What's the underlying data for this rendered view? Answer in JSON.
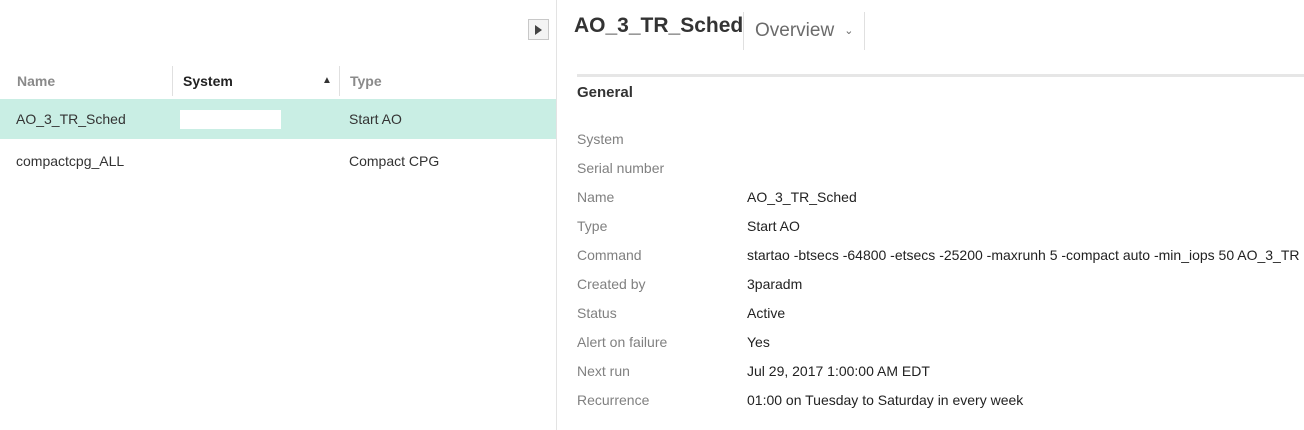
{
  "list": {
    "columns": [
      {
        "label": "Name"
      },
      {
        "label": "System",
        "sort": "ascending"
      },
      {
        "label": "Type"
      }
    ],
    "rows": [
      {
        "name": "AO_3_TR_Sched",
        "system": "",
        "type": "Start AO",
        "selected": true
      },
      {
        "name": "compactcpg_ALL",
        "system": "",
        "type": "Compact CPG",
        "selected": false
      }
    ],
    "collapse_icon": "collapse-pane-icon",
    "sort_icon": "sort-ascending-icon"
  },
  "detail": {
    "title": "AO_3_TR_Sched",
    "view_selector": {
      "label": "Overview",
      "icon": "chevron-down-icon"
    },
    "section_title": "General",
    "properties": [
      {
        "label": "System",
        "value": ""
      },
      {
        "label": "Serial number",
        "value": ""
      },
      {
        "label": "Name",
        "value": "AO_3_TR_Sched"
      },
      {
        "label": "Type",
        "value": "Start AO"
      },
      {
        "label": "Command",
        "value": "startao -btsecs -64800 -etsecs -25200 -maxrunh 5 -compact auto -min_iops 50 AO_3_TR"
      },
      {
        "label": "Created by",
        "value": "3paradm"
      },
      {
        "label": "Status",
        "value": "Active"
      },
      {
        "label": "Alert on failure",
        "value": "Yes"
      },
      {
        "label": "Next run",
        "value": "Jul 29, 2017 1:00:00 AM EDT"
      },
      {
        "label": "Recurrence",
        "value": "01:00 on Tuesday to Saturday in every week"
      }
    ]
  },
  "colors": {
    "selected_row": "#c9eee4",
    "label_text": "#808080",
    "value_text": "#222222"
  }
}
